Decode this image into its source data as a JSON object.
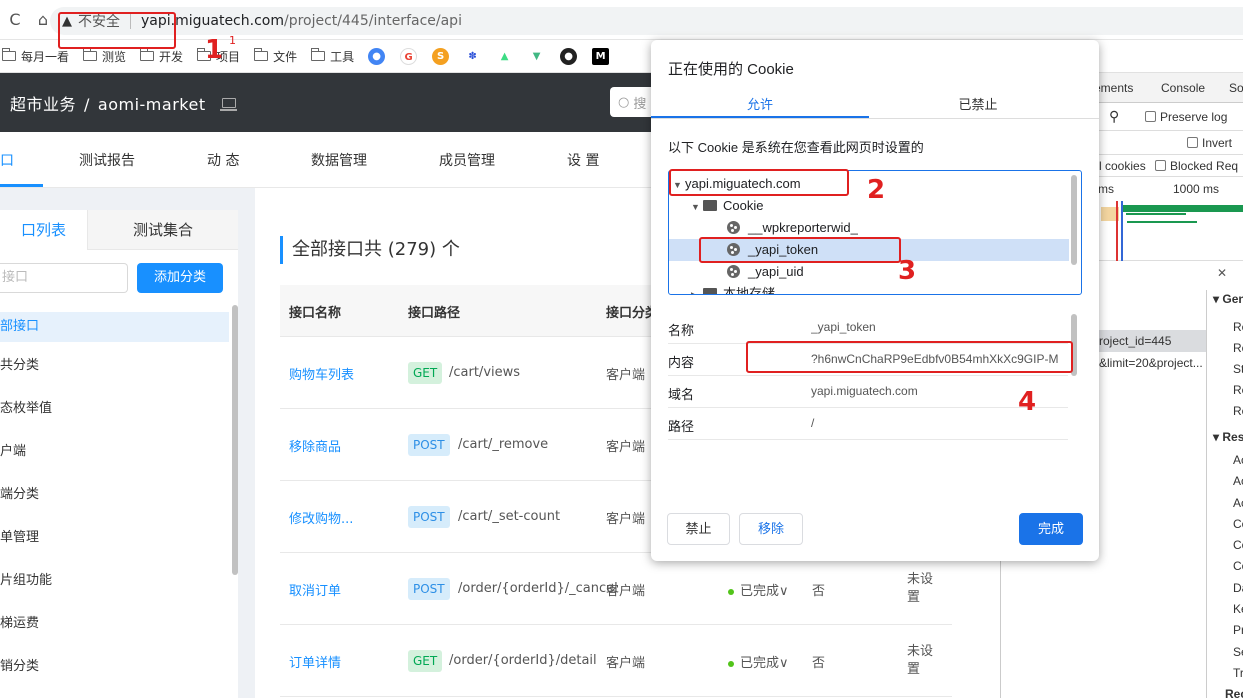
{
  "browser": {
    "reload_icon": "reload-icon",
    "home_icon": "home-icon",
    "security_label": "不安全",
    "url_host": "yapi.miguatech.com",
    "url_path": "/project/445/interface/api"
  },
  "bookmarks": {
    "folders": [
      "每月一看",
      "测览",
      "开发",
      "项目",
      "文件",
      "工具"
    ],
    "extensions": [
      "chrome-icon",
      "google-icon",
      "s-icon",
      "paw-icon",
      "android-icon",
      "vue-icon",
      "github-icon",
      "m-icon"
    ]
  },
  "app": {
    "title_cn": "超市业务",
    "slash": "/",
    "title_en": "aomi-market",
    "search_placeholder": "搜"
  },
  "subnav": {
    "items": [
      "口",
      "测试报告",
      "动 态",
      "数据管理",
      "成员管理",
      "设 置"
    ]
  },
  "left": {
    "tab_active": "口列表",
    "tab_inactive": "测试集合",
    "search_placeholder": "接口",
    "add_button": "添加分类",
    "categories": [
      "部接口",
      "共分类",
      "态枚举值",
      "户端",
      "端分类",
      "单管理",
      "片组功能",
      "梯运费",
      "销分类"
    ]
  },
  "main": {
    "title": "全部接口共 (279) 个",
    "columns": [
      "接口名称",
      "接口路径",
      "接口分类"
    ],
    "rows": [
      {
        "name": "购物车列表",
        "method": "GET",
        "path": "/cart/views",
        "category": "客户端",
        "status": "",
        "tag": "",
        "unset": ""
      },
      {
        "name": "移除商品",
        "method": "POST",
        "path": "/cart/_remove",
        "category": "客户端",
        "status": "",
        "tag": "",
        "unset": ""
      },
      {
        "name": "修改购物...",
        "method": "POST",
        "path": "/cart/_set-count",
        "category": "客户端",
        "status": "",
        "tag": "",
        "unset": ""
      },
      {
        "name": "取消订单",
        "method": "POST",
        "path": "/order/{orderId}/_cancel",
        "category": "客户端",
        "status": "已完成∨",
        "tag": "否",
        "unset": "未设置"
      },
      {
        "name": "订单详情",
        "method": "GET",
        "path": "/order/{orderId}/detail",
        "category": "客户端",
        "status": "已完成∨",
        "tag": "否",
        "unset": "未设置"
      }
    ]
  },
  "devtools": {
    "tabs": [
      "ements",
      "Console",
      "So"
    ],
    "preserve_log": "Preserve log",
    "invert": "Invert",
    "cookies_label": "l cookies",
    "blocked_req": "Blocked Req",
    "timeline_ms_a": "ms",
    "timeline_ms_b": "1000 ms",
    "close_icon": "close-icon",
    "requests": [
      "roject_id=445",
      "&limit=20&project..."
    ],
    "section_general": "Gen",
    "general_rows": [
      "Re",
      "Re",
      "St",
      "Re",
      "Re"
    ],
    "section_response": "Res",
    "response_rows": [
      "Ac",
      "Ac",
      "Ac",
      "Co",
      "Co",
      "Co",
      "Da",
      "Ke",
      "Pr",
      "Se",
      "Tr"
    ],
    "bottom_cut": "Rec"
  },
  "dialog": {
    "title": "正在使用的 Cookie",
    "tab_allowed": "允许",
    "tab_blocked": "已禁止",
    "description": "以下 Cookie 是系统在您查看此网页时设置的",
    "tree": {
      "domain": "yapi.miguatech.com",
      "folder": "Cookie",
      "cookies": [
        "__wpkreporterwid_",
        "_yapi_token",
        "_yapi_uid"
      ],
      "local_storage": "本地存储"
    },
    "details": [
      {
        "label": "名称",
        "value": "_yapi_token"
      },
      {
        "label": "内容",
        "value": "?h6nwCnChaRP9eEdbfv0B54mhXkXc9GIP-M"
      },
      {
        "label": "域名",
        "value": "yapi.miguatech.com"
      },
      {
        "label": "路径",
        "value": "/"
      }
    ],
    "btn_block": "禁止",
    "btn_remove": "移除",
    "btn_done": "完成"
  },
  "annotations": {
    "n1": "1",
    "n1_small": "1",
    "n2": "2",
    "n3": "3",
    "n4": "4",
    "color": "#e02020"
  }
}
